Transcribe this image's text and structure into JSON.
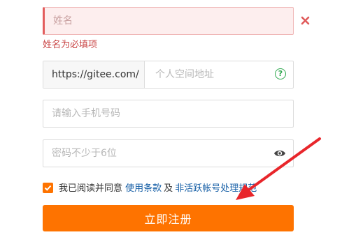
{
  "form": {
    "name": {
      "placeholder": "姓名",
      "value": "",
      "error": "姓名为必填项"
    },
    "url": {
      "prefix": "https://gitee.com/",
      "placeholder": "个人空间地址",
      "help_icon": "question-circle-icon",
      "help_glyph": "?"
    },
    "phone": {
      "placeholder": "请输入手机号码"
    },
    "password": {
      "placeholder": "密码不少于6位",
      "icon": "eye-icon"
    },
    "agreement": {
      "checked": true,
      "prefix": "我已阅读并同意",
      "terms_link": "使用条款",
      "conjunction": "及",
      "policy_link": "非活跃帐号处理规范"
    },
    "submit_label": "立即注册"
  },
  "colors": {
    "accent": "#fe7300",
    "error": "#e35d5d",
    "link": "#155ea6",
    "help": "#2fa84f",
    "annotation_arrow": "#e8262b"
  }
}
